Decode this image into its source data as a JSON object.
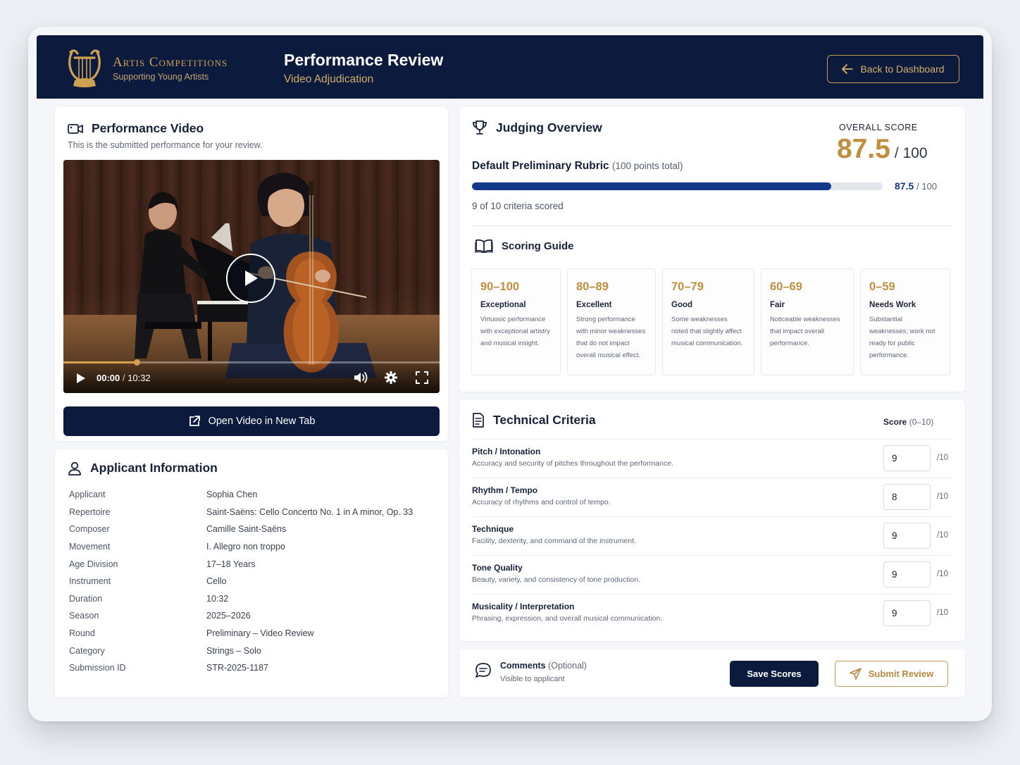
{
  "brand": {
    "name": "Artis Competitions",
    "tagline": "Supporting Young Artists",
    "color": "#cfa153"
  },
  "header": {
    "title": "Performance Review",
    "subtitle": "Video Adjudication",
    "back_label": "Back to Dashboard"
  },
  "video": {
    "title": "Performance Video",
    "description": "This is the submitted performance for your review.",
    "current_time": "00:00",
    "separator": "/",
    "duration": "10:32",
    "progress_fraction": 0.195,
    "open_label": "Open Video in New Tab"
  },
  "applicant": {
    "title": "Applicant Information",
    "fields": [
      {
        "label": "Applicant",
        "value": "Sophia Chen"
      },
      {
        "label": "Repertoire",
        "value": "Saint-Saëns: Cello Concerto No. 1 in A minor, Op. 33"
      },
      {
        "label": "Composer",
        "value": "Camille Saint-Saëns"
      },
      {
        "label": "Movement",
        "value": "I. Allegro non troppo"
      },
      {
        "label": "Age Division",
        "value": "17–18 Years"
      },
      {
        "label": "Instrument",
        "value": "Cello"
      },
      {
        "label": "Duration",
        "value": "10:32"
      },
      {
        "label": "Season",
        "value": "2025–2026"
      },
      {
        "label": "Round",
        "value": "Preliminary – Video Review"
      },
      {
        "label": "Category",
        "value": "Strings – Solo"
      },
      {
        "label": "Submission ID",
        "value": "STR-2025-1187"
      }
    ]
  },
  "judging": {
    "title": "Judging Overview",
    "rubric_name": "Default Preliminary Rubric",
    "rubric_points": "(100 points total)",
    "overall_label": "OVERALL SCORE",
    "overall_score": "87.5",
    "overall_of": "/ 100",
    "bar_score": "87.5",
    "bar_of": "/ 100",
    "progress_fraction": 0.875,
    "criteria_count": "9 of 10 criteria scored",
    "accent": "#12388a",
    "gold": "#c08f3d"
  },
  "guide": {
    "title": "Scoring Guide",
    "bands": [
      {
        "range": "90–100",
        "level": "Exceptional",
        "text": "Virtuosic performance with exceptional artistry and musical insight."
      },
      {
        "range": "80–89",
        "level": "Excellent",
        "text": "Strong performance with minor weaknesses that do not impact overall musical effect."
      },
      {
        "range": "70–79",
        "level": "Good",
        "text": "Some weaknesses noted that slightly affect musical communication."
      },
      {
        "range": "60–69",
        "level": "Fair",
        "text": "Noticeable weaknesses that impact overall performance."
      },
      {
        "range": "0–59",
        "level": "Needs Work",
        "text": "Substantial weaknesses; work not ready for public performance."
      }
    ]
  },
  "technical": {
    "title": "Technical Criteria",
    "score_label": "Score",
    "score_range": "(0–10)",
    "criteria": [
      {
        "name": "Pitch / Intonation",
        "desc": "Accuracy and security of pitches throughout the performance.",
        "score": "9",
        "of": "/10"
      },
      {
        "name": "Rhythm / Tempo",
        "desc": "Accuracy of rhythms and control of tempo.",
        "score": "8",
        "of": "/10"
      },
      {
        "name": "Technique",
        "desc": "Facility, dexterity, and command of the instrument.",
        "score": "9",
        "of": "/10"
      },
      {
        "name": "Tone Quality",
        "desc": "Beauty, variety, and consistency of tone production.",
        "score": "9",
        "of": "/10"
      },
      {
        "name": "Musicality / Interpretation",
        "desc": "Phrasing, expression, and overall musical communication.",
        "score": "9",
        "of": "/10"
      }
    ]
  },
  "comments": {
    "title": "Comments",
    "optional": "(Optional)",
    "sub": "Visible to applicant",
    "save_label": "Save Scores",
    "submit_label": "Submit Review"
  },
  "icons": {
    "logo": "lyre-icon",
    "back": "arrow-left-icon",
    "video": "video-camera-icon",
    "play": "play-icon",
    "volume": "volume-icon",
    "settings": "gear-icon",
    "fullscreen": "fullscreen-icon",
    "external": "external-link-icon",
    "user": "user-icon",
    "trophy": "trophy-icon",
    "book": "book-icon",
    "document": "document-icon",
    "chat": "chat-icon",
    "send": "send-icon"
  }
}
